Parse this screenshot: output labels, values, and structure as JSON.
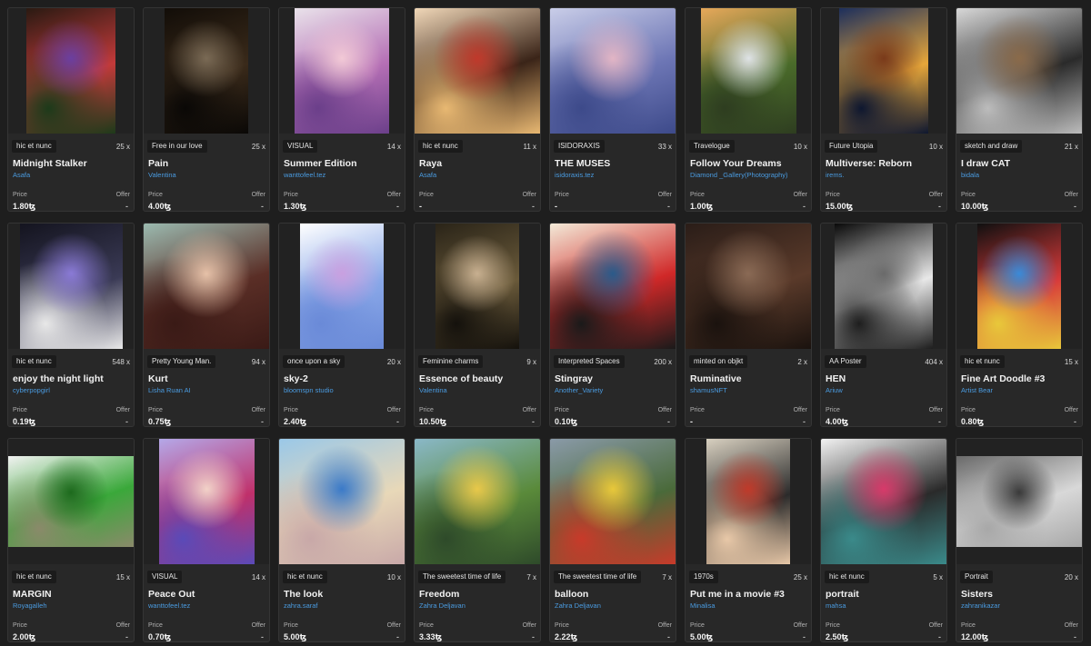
{
  "cards": [
    {
      "tag": "hic et nunc",
      "editions": "25 x",
      "title": "Midnight Stalker",
      "artist": "Asafa",
      "price_label": "Price",
      "price": "1.80ꜩ",
      "offer_label": "Offer",
      "offer": "-",
      "colors": [
        "#2a1a12",
        "#c23a3a",
        "#6b3fa0",
        "#1d3a1a"
      ]
    },
    {
      "tag": "Free in our love",
      "editions": "25 x",
      "title": "Pain",
      "artist": "Valentina",
      "price_label": "Price",
      "price": "4.00ꜩ",
      "offer_label": "Offer",
      "offer": "-",
      "colors": [
        "#120d08",
        "#3a2a1a",
        "#7a6a55",
        "#0a0806"
      ]
    },
    {
      "tag": "VISUAL",
      "editions": "14 x",
      "title": "Summer Edition",
      "artist": "wanttofeel.tez",
      "price_label": "Price",
      "price": "1.30ꜩ",
      "offer_label": "Offer",
      "offer": "-",
      "colors": [
        "#e9e2ea",
        "#b56fb5",
        "#f2c9d6",
        "#6b3f8a"
      ]
    },
    {
      "tag": "hic et nunc",
      "editions": "11 x",
      "title": "Raya",
      "artist": "Asafa",
      "price_label": "Price",
      "price": "-",
      "offer_label": "Offer",
      "offer": "-",
      "colors": [
        "#f0d7b8",
        "#3a2418",
        "#c0392b",
        "#e8b872"
      ]
    },
    {
      "tag": "ISIDORAXIS",
      "editions": "33 x",
      "title": "THE MUSES",
      "artist": "isidoraxis.tez",
      "price_label": "Price",
      "price": "-",
      "offer_label": "Offer",
      "offer": "-",
      "colors": [
        "#c9cde8",
        "#6d76b5",
        "#e2b5c5",
        "#3d4a8a"
      ]
    },
    {
      "tag": "Travelogue",
      "editions": "10 x",
      "title": "Follow Your Dreams",
      "artist": "Diamond _Gallery(Photography)",
      "price_label": "Price",
      "price": "1.00ꜩ",
      "offer_label": "Offer",
      "offer": "-",
      "colors": [
        "#e7a85a",
        "#4a6b2a",
        "#dfe3e6",
        "#2e3d20"
      ]
    },
    {
      "tag": "Future Utopia",
      "editions": "10 x",
      "title": "Multiverse: Reborn",
      "artist": "irems.",
      "price_label": "Price",
      "price": "15.00ꜩ",
      "offer_label": "Offer",
      "offer": "-",
      "colors": [
        "#1d2f5c",
        "#e6a63a",
        "#7a3a1a",
        "#0e1730"
      ]
    },
    {
      "tag": "sketch and draw",
      "editions": "21 x",
      "title": "I draw CAT",
      "artist": "bidala",
      "price_label": "Price",
      "price": "10.00ꜩ",
      "offer_label": "Offer",
      "offer": "-",
      "colors": [
        "#d8d8d8",
        "#2a2a2a",
        "#8a6a4a",
        "#bcbcbc"
      ]
    },
    {
      "tag": "hic et nunc",
      "editions": "548 x",
      "title": "enjoy the night light",
      "artist": "cyberpopgirl",
      "price_label": "Price",
      "price": "0.19ꜩ",
      "offer_label": "Offer",
      "offer": "-",
      "colors": [
        "#14141f",
        "#3a3a55",
        "#8a7ad6",
        "#e8e8e8"
      ]
    },
    {
      "tag": "Pretty Young Man.",
      "editions": "94 x",
      "title": "Kurt",
      "artist": "Lisha Ruan AI",
      "price_label": "Price",
      "price": "0.75ꜩ",
      "offer_label": "Offer",
      "offer": "-",
      "colors": [
        "#9bbab0",
        "#5a2e26",
        "#e6c1a8",
        "#3a1a16"
      ]
    },
    {
      "tag": "once upon a sky",
      "editions": "20 x",
      "title": "sky-2",
      "artist": "bloomspn studio",
      "price_label": "Price",
      "price": "2.40ꜩ",
      "offer_label": "Offer",
      "offer": "-",
      "colors": [
        "#ffffff",
        "#8aa8e8",
        "#c9a0e0",
        "#6a8ad8"
      ]
    },
    {
      "tag": "Feminine charms",
      "editions": "9 x",
      "title": "Essence of beauty",
      "artist": "Valentina",
      "price_label": "Price",
      "price": "10.50ꜩ",
      "offer_label": "Offer",
      "offer": "-",
      "colors": [
        "#2a2418",
        "#6a5a3a",
        "#c8b090",
        "#14110c"
      ]
    },
    {
      "tag": "Interpreted Spaces",
      "editions": "200 x",
      "title": "Stingray",
      "artist": "Another_Variety",
      "price_label": "Price",
      "price": "0.10ꜩ",
      "offer_label": "Offer",
      "offer": "-",
      "colors": [
        "#f3ead8",
        "#d02828",
        "#2a5a8a",
        "#1a1a1a"
      ]
    },
    {
      "tag": "minted on objkt",
      "editions": "2 x",
      "title": "Ruminative",
      "artist": "shamusNFT",
      "price_label": "Price",
      "price": "-",
      "offer_label": "Offer",
      "offer": "-",
      "colors": [
        "#2a1d18",
        "#5a3a2a",
        "#8a6a55",
        "#1a120e"
      ]
    },
    {
      "tag": "AA Poster",
      "editions": "404 x",
      "title": "HEN",
      "artist": "Ariuw",
      "price_label": "Price",
      "price": "4.00ꜩ",
      "offer_label": "Offer",
      "offer": "-",
      "colors": [
        "#0a0a0a",
        "#e8e8e8",
        "#6a6a6a",
        "#1e1e1e"
      ]
    },
    {
      "tag": "hic et nunc",
      "editions": "15 x",
      "title": "Fine Art Doodle #3",
      "artist": "Artist Bear",
      "price_label": "Price",
      "price": "0.80ꜩ",
      "offer_label": "Offer",
      "offer": "-",
      "colors": [
        "#101010",
        "#d83a3a",
        "#3a8ad8",
        "#e8c83a"
      ]
    },
    {
      "tag": "hic et nunc",
      "editions": "15 x",
      "title": "MARGIN",
      "artist": "Royagalleh",
      "price_label": "Price",
      "price": "2.00ꜩ",
      "offer_label": "Offer",
      "offer": "-",
      "colors": [
        "#f2f2f2",
        "#3aa83a",
        "#1d6a1d",
        "#8a8a6a"
      ]
    },
    {
      "tag": "VISUAL",
      "editions": "14 x",
      "title": "Peace Out",
      "artist": "wanttofeel.tez",
      "price_label": "Price",
      "price": "0.70ꜩ",
      "offer_label": "Offer",
      "offer": "-",
      "colors": [
        "#b4a8e8",
        "#c0306a",
        "#f2d2c8",
        "#5a4ab8"
      ]
    },
    {
      "tag": "hic et nunc",
      "editions": "10 x",
      "title": "The look",
      "artist": "zahra.saraf",
      "price_label": "Price",
      "price": "5.00ꜩ",
      "offer_label": "Offer",
      "offer": "-",
      "colors": [
        "#9ac8e8",
        "#e8d8b8",
        "#3a7ac8",
        "#c8a8a8"
      ]
    },
    {
      "tag": "The sweetest time of life",
      "editions": "7 x",
      "title": "Freedom",
      "artist": "Zahra Deljavan",
      "price_label": "Price",
      "price": "3.33ꜩ",
      "offer_label": "Offer",
      "offer": "-",
      "colors": [
        "#8ab8c8",
        "#5a8a3a",
        "#e8c84a",
        "#2e4a2a"
      ]
    },
    {
      "tag": "The sweetest time of life",
      "editions": "7 x",
      "title": "balloon",
      "artist": "Zahra Deljavan",
      "price_label": "Price",
      "price": "2.22ꜩ",
      "offer_label": "Offer",
      "offer": "-",
      "colors": [
        "#8a9aa8",
        "#4a6a3a",
        "#e8c83a",
        "#c83a2a"
      ]
    },
    {
      "tag": "1970s",
      "editions": "25 x",
      "title": "Put me in a movie #3",
      "artist": "Minalisa",
      "price_label": "Price",
      "price": "5.00ꜩ",
      "offer_label": "Offer",
      "offer": "-",
      "colors": [
        "#d8d0c0",
        "#2a2a2a",
        "#c03a2a",
        "#e8c8a8"
      ]
    },
    {
      "tag": "hic et nunc",
      "editions": "5 x",
      "title": "portrait",
      "artist": "mahsa",
      "price_label": "Price",
      "price": "2.50ꜩ",
      "offer_label": "Offer",
      "offer": "-",
      "colors": [
        "#f2f2f2",
        "#2a2a2a",
        "#d83a6a",
        "#3a8a8a"
      ]
    },
    {
      "tag": "Portrait",
      "editions": "20 x",
      "title": "Sisters",
      "artist": "zahranikazar",
      "price_label": "Price",
      "price": "12.00ꜩ",
      "offer_label": "Offer",
      "offer": "-",
      "colors": [
        "#6a6a6a",
        "#d8d8d8",
        "#3a3a3a",
        "#a8a8a8"
      ]
    }
  ]
}
